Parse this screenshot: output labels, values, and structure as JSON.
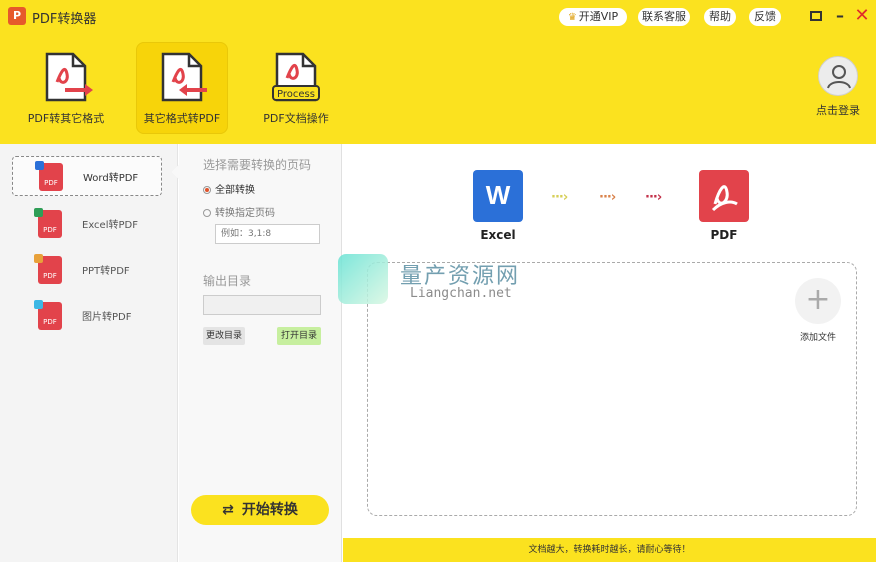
{
  "titlebar": {
    "app_logo": "P",
    "title": "PDF转换器",
    "vip_label": "开通VIP",
    "service_label": "联系客服",
    "help_label": "帮助",
    "feedback_label": "反馈"
  },
  "toolbar": {
    "tools": [
      {
        "label": "PDF转其它格式"
      },
      {
        "label": "其它格式转PDF"
      },
      {
        "label": "PDF文档操作",
        "badge": "Process"
      }
    ],
    "login_label": "点击登录"
  },
  "sidebar": {
    "items": [
      {
        "label": "Word转PDF",
        "icon_text": "PDF",
        "mini_color": "#2b70d8"
      },
      {
        "label": "Excel转PDF",
        "icon_text": "PDF",
        "mini_color": "#2f9e57"
      },
      {
        "label": "PPT转PDF",
        "icon_text": "PDF",
        "mini_color": "#e8a13a"
      },
      {
        "label": "图片转PDF",
        "icon_text": "PDF",
        "mini_color": "#3db7e4"
      }
    ]
  },
  "options": {
    "pages_heading": "选择需要转换的页码",
    "all_pages_label": "全部转换",
    "specific_pages_label": "转换指定页码",
    "page_input_placeholder": "例如：3,1:8",
    "output_heading": "输出目录",
    "change_dir_label": "更改目录",
    "open_dir_label": "打开目录",
    "start_label": "开始转换"
  },
  "main": {
    "source_letter": "W",
    "source_label": "Excel",
    "target_label": "PDF",
    "add_file_label": "添加文件"
  },
  "watermark": {
    "title": "量产资源网",
    "url": "Liangchan.net"
  },
  "status": {
    "message": "文档越大，转换耗时越长，请耐心等待！"
  },
  "colors": {
    "brand_yellow": "#fbe21f",
    "pdf_red": "#e2434b",
    "word_blue": "#2b70d8"
  }
}
